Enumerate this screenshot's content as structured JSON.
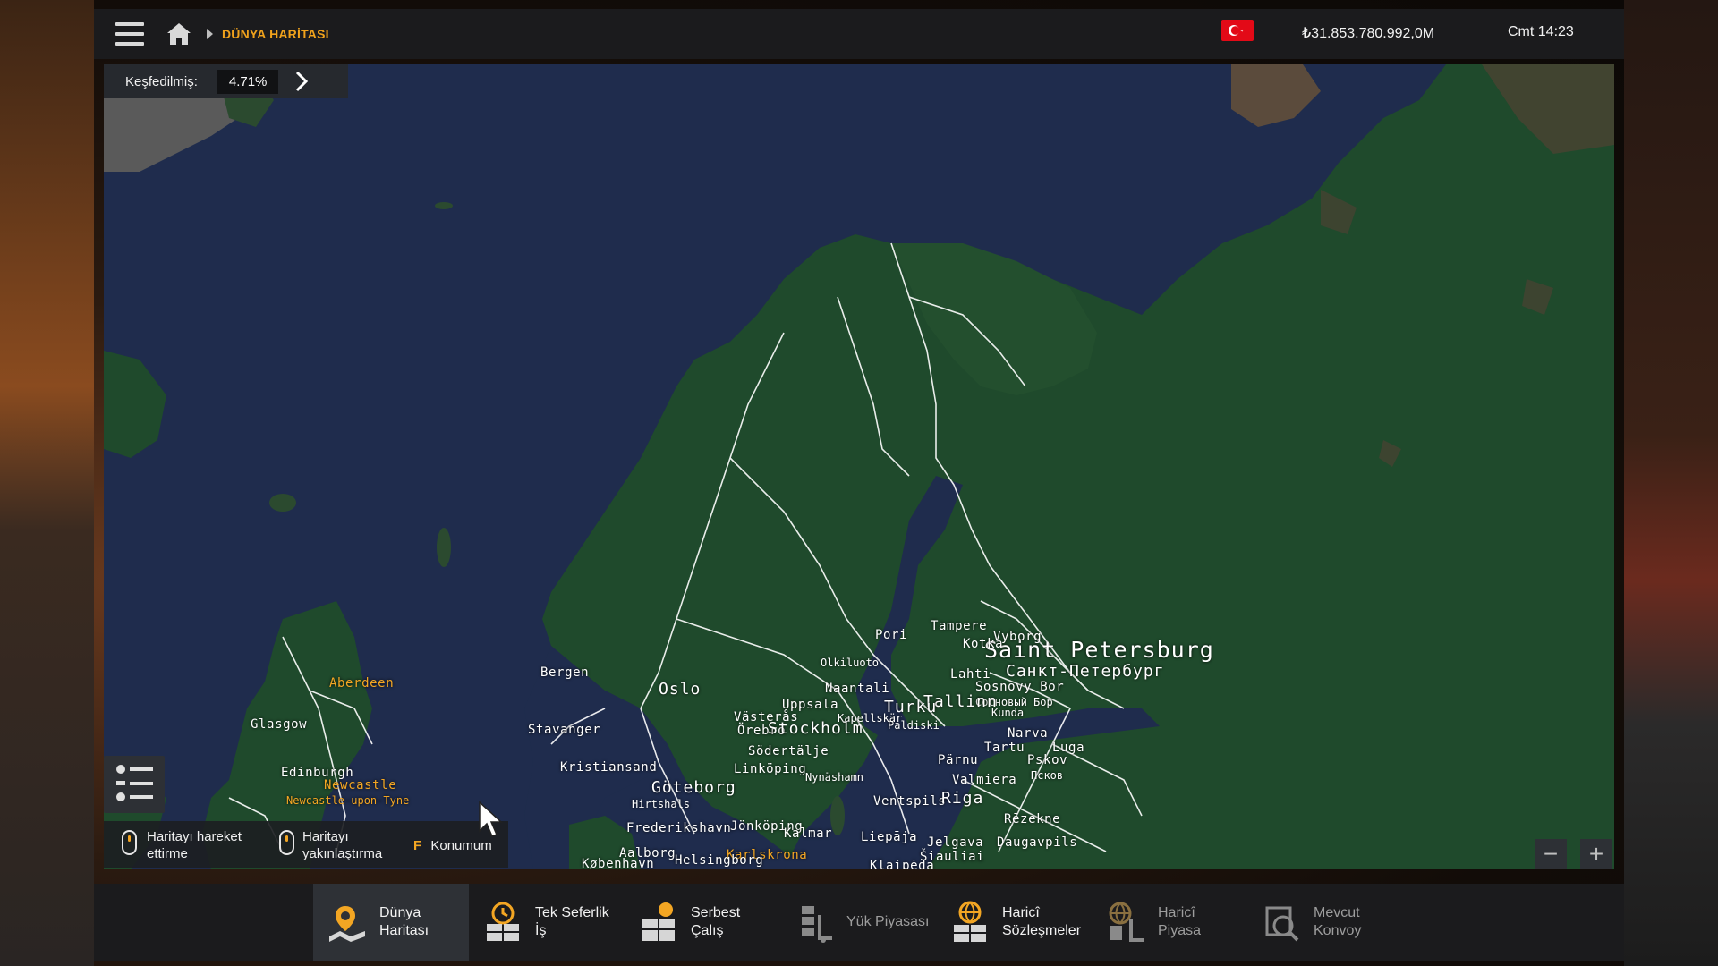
{
  "header": {
    "breadcrumb": "DÜNYA HARİTASI",
    "money": "₺31.853.780.992,0M",
    "clock": "Cmt 14:23",
    "flag_color": "#e30a17"
  },
  "explored": {
    "label": "Keşfedilmiş:",
    "value": "4.71%"
  },
  "map": {
    "cities": [
      {
        "name": "Saint Petersburg",
        "style": "big",
        "color": "white"
      },
      {
        "name": "Санкт-Петербург",
        "style": "med",
        "color": "white"
      },
      {
        "name": "Tampere",
        "style": "small",
        "color": "white"
      },
      {
        "name": "Pori",
        "style": "small",
        "color": "white"
      },
      {
        "name": "Kotka",
        "style": "small",
        "color": "white"
      },
      {
        "name": "Vyborg",
        "style": "small",
        "color": "white"
      },
      {
        "name": "Olkiluoto",
        "style": "tiny",
        "color": "white"
      },
      {
        "name": "Lahti",
        "style": "small",
        "color": "white"
      },
      {
        "name": "Sosnovy Bor",
        "style": "small",
        "color": "white"
      },
      {
        "name": "Сосновый Бор",
        "style": "tiny",
        "color": "white"
      },
      {
        "name": "Kunda",
        "style": "tiny",
        "color": "white"
      },
      {
        "name": "Naantali",
        "style": "small",
        "color": "white"
      },
      {
        "name": "Tallinn",
        "style": "med",
        "color": "white"
      },
      {
        "name": "Turku",
        "style": "med",
        "color": "white"
      },
      {
        "name": "Paldiski",
        "style": "tiny",
        "color": "white"
      },
      {
        "name": "Kapellskär",
        "style": "tiny",
        "color": "white"
      },
      {
        "name": "Narva",
        "style": "small",
        "color": "white"
      },
      {
        "name": "Tartu",
        "style": "small",
        "color": "white"
      },
      {
        "name": "Luga",
        "style": "small",
        "color": "white"
      },
      {
        "name": "Pskov",
        "style": "small",
        "color": "white"
      },
      {
        "name": "Псков",
        "style": "tiny",
        "color": "white"
      },
      {
        "name": "Pärnu",
        "style": "small",
        "color": "white"
      },
      {
        "name": "Valmiera",
        "style": "small",
        "color": "white"
      },
      {
        "name": "Ventspils",
        "style": "small",
        "color": "white"
      },
      {
        "name": "Riga",
        "style": "med",
        "color": "white"
      },
      {
        "name": "Rēzekne",
        "style": "small",
        "color": "white"
      },
      {
        "name": "Liepāja",
        "style": "small",
        "color": "white"
      },
      {
        "name": "Jelgava",
        "style": "small",
        "color": "white"
      },
      {
        "name": "Daugavpils",
        "style": "small",
        "color": "white"
      },
      {
        "name": "Šiauliai",
        "style": "small",
        "color": "white"
      },
      {
        "name": "Klaipėda",
        "style": "small",
        "color": "white"
      },
      {
        "name": "Bergen",
        "style": "small",
        "color": "white"
      },
      {
        "name": "Oslo",
        "style": "med",
        "color": "white"
      },
      {
        "name": "Stavanger",
        "style": "small",
        "color": "white"
      },
      {
        "name": "Kristiansand",
        "style": "small",
        "color": "white"
      },
      {
        "name": "Uppsala",
        "style": "small",
        "color": "white"
      },
      {
        "name": "Västerås",
        "style": "small",
        "color": "white"
      },
      {
        "name": "Örebro",
        "style": "small",
        "color": "white"
      },
      {
        "name": "Stockholm",
        "style": "med",
        "color": "white"
      },
      {
        "name": "Södertälje",
        "style": "small",
        "color": "white"
      },
      {
        "name": "Linköping",
        "style": "small",
        "color": "white"
      },
      {
        "name": "Nynäshamn",
        "style": "tiny",
        "color": "white"
      },
      {
        "name": "Göteborg",
        "style": "med",
        "color": "white"
      },
      {
        "name": "Hirtshals",
        "style": "tiny",
        "color": "white"
      },
      {
        "name": "Frederikshavn",
        "style": "small",
        "color": "white"
      },
      {
        "name": "Jönköping",
        "style": "small",
        "color": "white"
      },
      {
        "name": "Kalmar",
        "style": "small",
        "color": "white"
      },
      {
        "name": "Karlskrona",
        "style": "small",
        "color": "orange"
      },
      {
        "name": "Aalborg",
        "style": "small",
        "color": "white"
      },
      {
        "name": "Helsingborg",
        "style": "small",
        "color": "white"
      },
      {
        "name": "København",
        "style": "small",
        "color": "white"
      },
      {
        "name": "Aberdeen",
        "style": "small",
        "color": "orange"
      },
      {
        "name": "Glasgow",
        "style": "small",
        "color": "white"
      },
      {
        "name": "Edinburgh",
        "style": "small",
        "color": "white"
      },
      {
        "name": "Newcastle",
        "style": "small",
        "color": "orange"
      },
      {
        "name": "Newcastle-upon-Tyne",
        "style": "tiny",
        "color": "orange"
      }
    ]
  },
  "hints": {
    "move_label": "Haritayı hareket\nettirme",
    "zoom_label": "Haritayı\nyakınlaştırma",
    "locate_key": "F",
    "locate_label": "Konumum"
  },
  "nav": [
    {
      "label": "Dünya\nHaritası",
      "icon": "world-map-icon",
      "active": true,
      "dim": false
    },
    {
      "label": "Tek Seferlik\nİş",
      "icon": "quick-job-icon",
      "active": false,
      "dim": false
    },
    {
      "label": "Serbest\nÇalış",
      "icon": "freight-market-icon",
      "active": false,
      "dim": false
    },
    {
      "label": "Yük Piyasası",
      "icon": "cargo-market-icon",
      "active": false,
      "dim": true
    },
    {
      "label": "Haricî\nSözleşmeler",
      "icon": "external-contracts-icon",
      "active": false,
      "dim": false
    },
    {
      "label": "Haricî\nPiyasa",
      "icon": "external-market-icon",
      "active": false,
      "dim": true
    },
    {
      "label": "Mevcut\nKonvoy",
      "icon": "convoy-icon",
      "active": false,
      "dim": true
    }
  ]
}
